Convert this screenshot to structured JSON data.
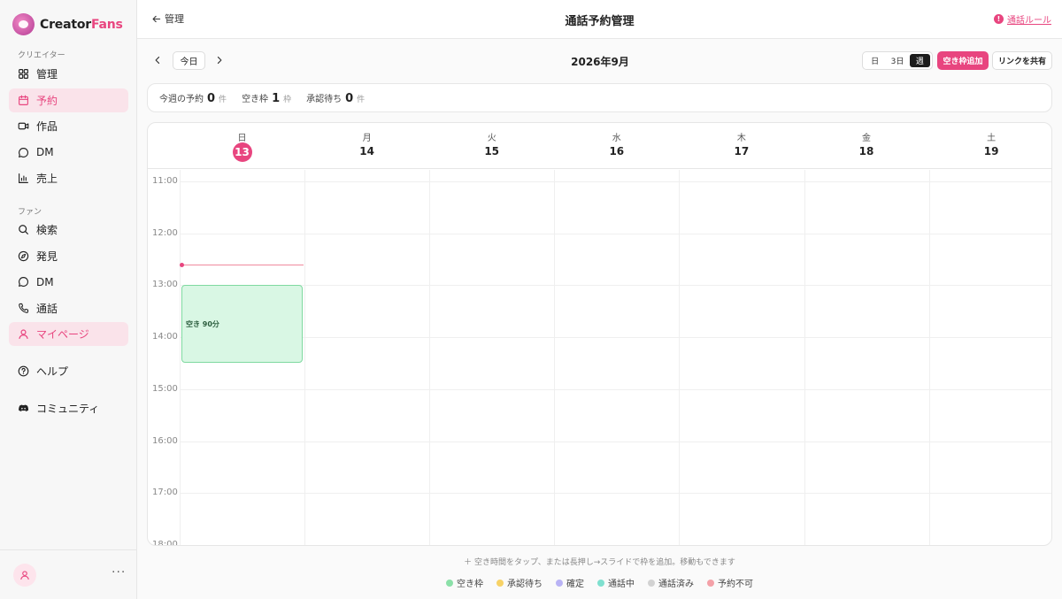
{
  "brand": {
    "name_main": "Creator",
    "name_accent": "Fans"
  },
  "sidebar": {
    "creator_label": "クリエイター",
    "creator_items": [
      {
        "label": "管理",
        "icon": "grid-icon"
      },
      {
        "label": "予約",
        "icon": "calendar-icon",
        "active": true
      },
      {
        "label": "作品",
        "icon": "video-icon"
      },
      {
        "label": "DM",
        "icon": "chat-icon"
      },
      {
        "label": "売上",
        "icon": "bar-chart-icon"
      }
    ],
    "fan_label": "ファン",
    "fan_items": [
      {
        "label": "検索",
        "icon": "search-icon"
      },
      {
        "label": "発見",
        "icon": "compass-icon"
      },
      {
        "label": "DM",
        "icon": "chat-icon"
      },
      {
        "label": "通話",
        "icon": "phone-icon"
      },
      {
        "label": "マイページ",
        "icon": "user-icon",
        "active": true
      }
    ],
    "help_label": "ヘルプ",
    "community_label": "コミュニティ",
    "more_label": "···"
  },
  "header": {
    "back_label": "管理",
    "title": "通話予約管理",
    "rule_link": "通話ルール"
  },
  "toolbar": {
    "today_label": "今日",
    "month_label": "2026年9月",
    "views": [
      "日",
      "3日",
      "週"
    ],
    "active_view": "週",
    "add_slot_label": "空き枠追加",
    "share_link_label": "リンクを共有"
  },
  "stats": [
    {
      "label": "今週の予約",
      "value": "0",
      "unit": "件"
    },
    {
      "label": "空き枠",
      "value": "1",
      "unit": "枠"
    },
    {
      "label": "承認待ち",
      "value": "0",
      "unit": "件"
    }
  ],
  "calendar": {
    "days": [
      {
        "dow": "日",
        "num": "13",
        "today": true
      },
      {
        "dow": "月",
        "num": "14"
      },
      {
        "dow": "火",
        "num": "15"
      },
      {
        "dow": "水",
        "num": "16"
      },
      {
        "dow": "木",
        "num": "17"
      },
      {
        "dow": "金",
        "num": "18"
      },
      {
        "dow": "土",
        "num": "19"
      }
    ],
    "time_labels": [
      "11:00",
      "12:00",
      "13:00",
      "14:00",
      "15:00",
      "16:00",
      "17:00",
      "18:00"
    ],
    "slot": {
      "label": "空き 90分",
      "start": "13:00",
      "duration_min": 90
    }
  },
  "hint": "＋ 空き時間をタップ、または長押し→スライドで枠を追加。移動もできます",
  "legend": [
    {
      "label": "空き枠",
      "color": "#8be0a8"
    },
    {
      "label": "承認待ち",
      "color": "#f7d266"
    },
    {
      "label": "確定",
      "color": "#b9b3f5"
    },
    {
      "label": "通話中",
      "color": "#7fe0cf"
    },
    {
      "label": "通話済み",
      "color": "#d2d2d2"
    },
    {
      "label": "予約不可",
      "color": "#f4a1a8"
    }
  ],
  "colors": {
    "accent": "#e8457f",
    "accent_soft": "#fae3ea",
    "slot_fill": "#d9f7e4"
  }
}
